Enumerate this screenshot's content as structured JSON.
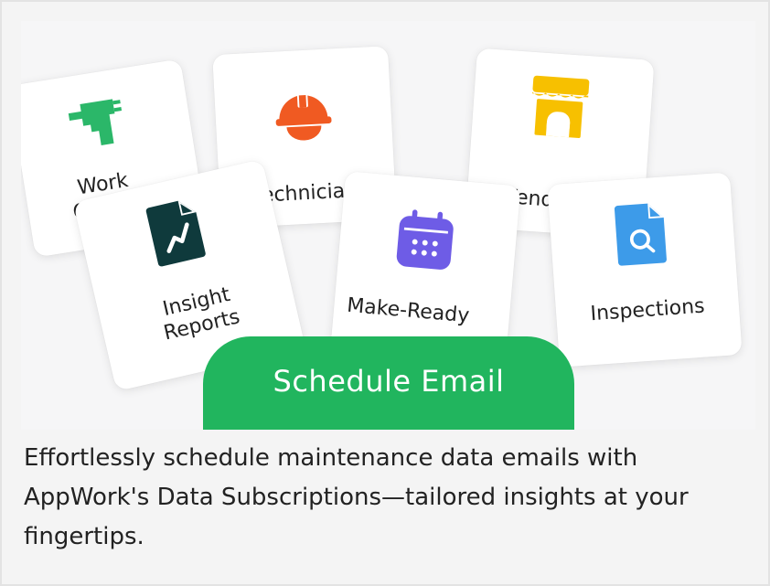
{
  "cards": {
    "work_orders": "Work Orders",
    "technicians": "Technicians",
    "vendors": "Vendors",
    "insight_reports": "Insight Reports",
    "make_ready": "Make-Ready",
    "inspections": "Inspections"
  },
  "cta": {
    "label": "Schedule Email"
  },
  "caption": "Effortlessly schedule maintenance data emails with AppWork's Data Subscriptions—tailored insights at your fingertips.",
  "colors": {
    "accent_green": "#21b55e",
    "tool_green": "#2bb769",
    "helmet_orange": "#f05a22",
    "store_yellow": "#f7c000",
    "report_dark": "#0f3a3c",
    "calendar_purple": "#6e5ce6",
    "inspect_blue": "#3d9be9"
  },
  "icons": [
    "drill-icon",
    "hard-hat-icon",
    "storefront-icon",
    "report-chart-icon",
    "calendar-icon",
    "search-document-icon"
  ]
}
